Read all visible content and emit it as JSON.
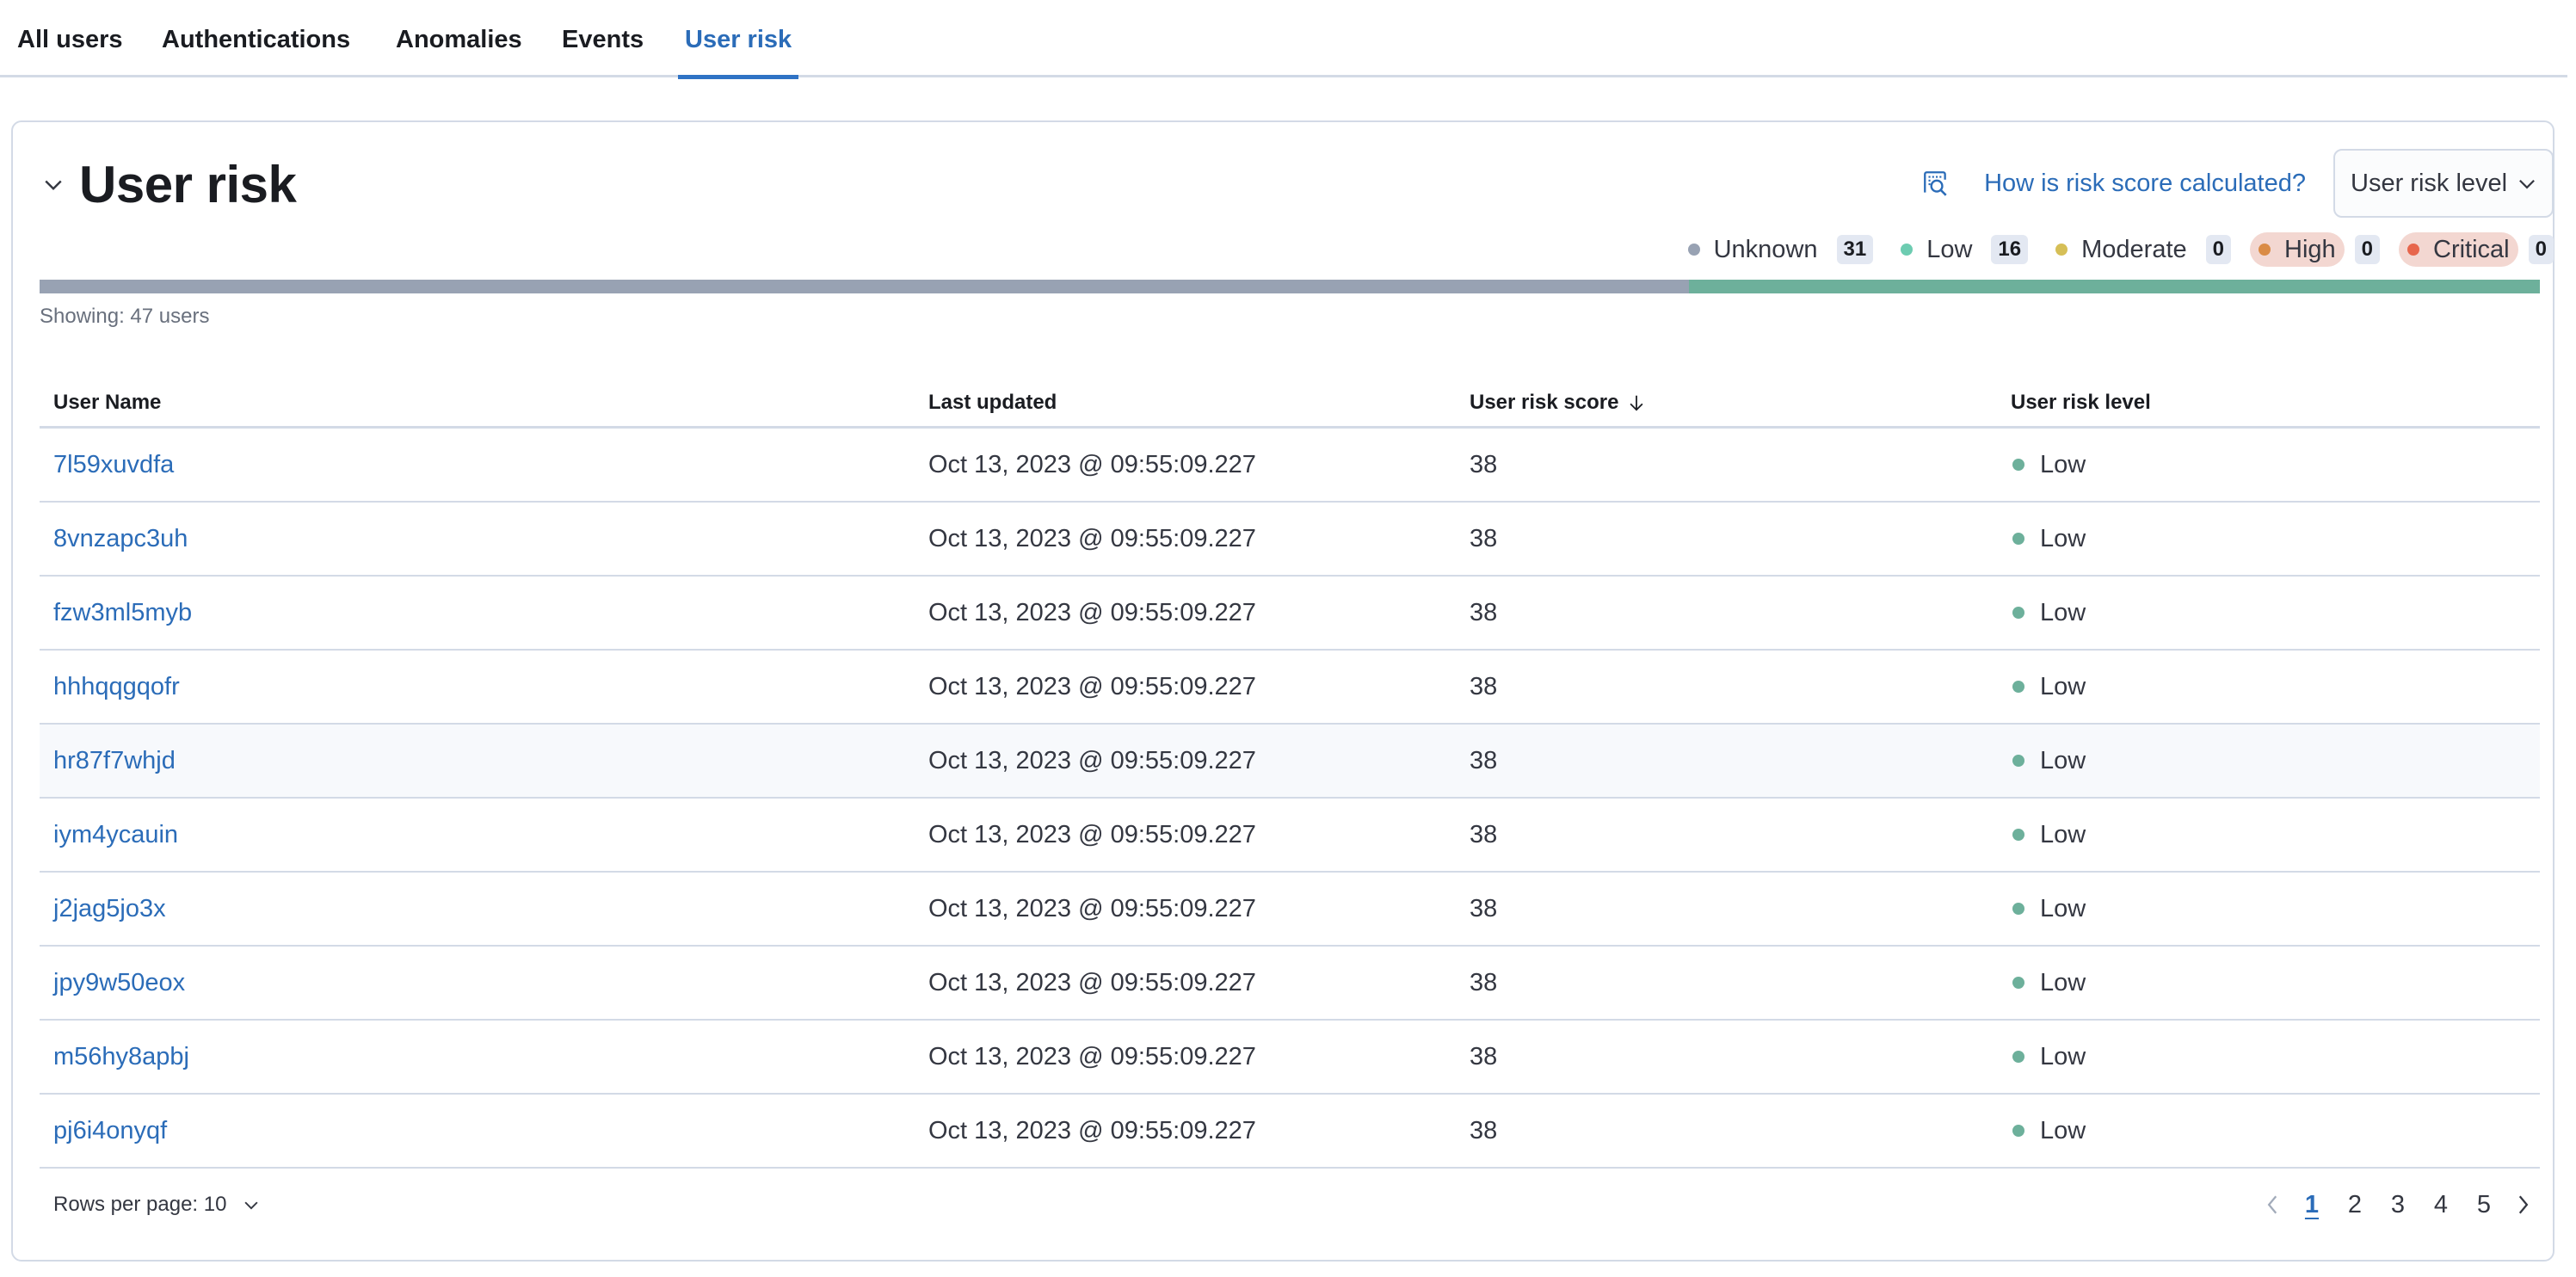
{
  "tabs": [
    {
      "label": "All users",
      "active": false
    },
    {
      "label": "Authentications",
      "active": false
    },
    {
      "label": "Anomalies",
      "active": false
    },
    {
      "label": "Events",
      "active": false
    },
    {
      "label": "User risk",
      "active": true
    }
  ],
  "panel": {
    "title": "User risk",
    "collapse_icon": "chevron-down-icon",
    "inspect_icon": "inspect-icon",
    "how_link": "How is risk score calculated?",
    "risk_level_select": "User risk level",
    "showing": "Showing: 47 users"
  },
  "legend": [
    {
      "label": "Unknown",
      "count": "31",
      "color": "#98a2b3",
      "pill": false
    },
    {
      "label": "Low",
      "count": "16",
      "color": "#6dccb1",
      "pill": false
    },
    {
      "label": "Moderate",
      "count": "0",
      "color": "#d6bf57",
      "pill": false
    },
    {
      "label": "High",
      "count": "0",
      "color": "#da8b45",
      "pill": true
    },
    {
      "label": "Critical",
      "count": "0",
      "color": "#e7664c",
      "pill": true
    }
  ],
  "risk_distribution": [
    {
      "level": "Unknown",
      "fraction": 0.6596,
      "color": "#98a2b3"
    },
    {
      "level": "Low",
      "fraction": 0.3404,
      "color": "#6db09b"
    }
  ],
  "table": {
    "columns": [
      "User Name",
      "Last updated",
      "User risk score",
      "User risk level"
    ],
    "sort_column": "User risk score",
    "sort_direction": "descending",
    "rows": [
      {
        "user": "7l59xuvdfa",
        "updated": "Oct 13, 2023 @ 09:55:09.227",
        "score": "38",
        "level": "Low"
      },
      {
        "user": "8vnzapc3uh",
        "updated": "Oct 13, 2023 @ 09:55:09.227",
        "score": "38",
        "level": "Low"
      },
      {
        "user": "fzw3ml5myb",
        "updated": "Oct 13, 2023 @ 09:55:09.227",
        "score": "38",
        "level": "Low"
      },
      {
        "user": "hhhqqgqofr",
        "updated": "Oct 13, 2023 @ 09:55:09.227",
        "score": "38",
        "level": "Low"
      },
      {
        "user": "hr87f7whjd",
        "updated": "Oct 13, 2023 @ 09:55:09.227",
        "score": "38",
        "level": "Low",
        "hover": true
      },
      {
        "user": "iym4ycauin",
        "updated": "Oct 13, 2023 @ 09:55:09.227",
        "score": "38",
        "level": "Low"
      },
      {
        "user": "j2jag5jo3x",
        "updated": "Oct 13, 2023 @ 09:55:09.227",
        "score": "38",
        "level": "Low"
      },
      {
        "user": "jpy9w50eox",
        "updated": "Oct 13, 2023 @ 09:55:09.227",
        "score": "38",
        "level": "Low"
      },
      {
        "user": "m56hy8apbj",
        "updated": "Oct 13, 2023 @ 09:55:09.227",
        "score": "38",
        "level": "Low"
      },
      {
        "user": "pj6i4onyqf",
        "updated": "Oct 13, 2023 @ 09:55:09.227",
        "score": "38",
        "level": "Low"
      }
    ],
    "level_color": "#6db09b"
  },
  "footer": {
    "rows_per_page": "Rows per page: 10",
    "pages": [
      "1",
      "2",
      "3",
      "4",
      "5"
    ],
    "current_page": "1"
  }
}
